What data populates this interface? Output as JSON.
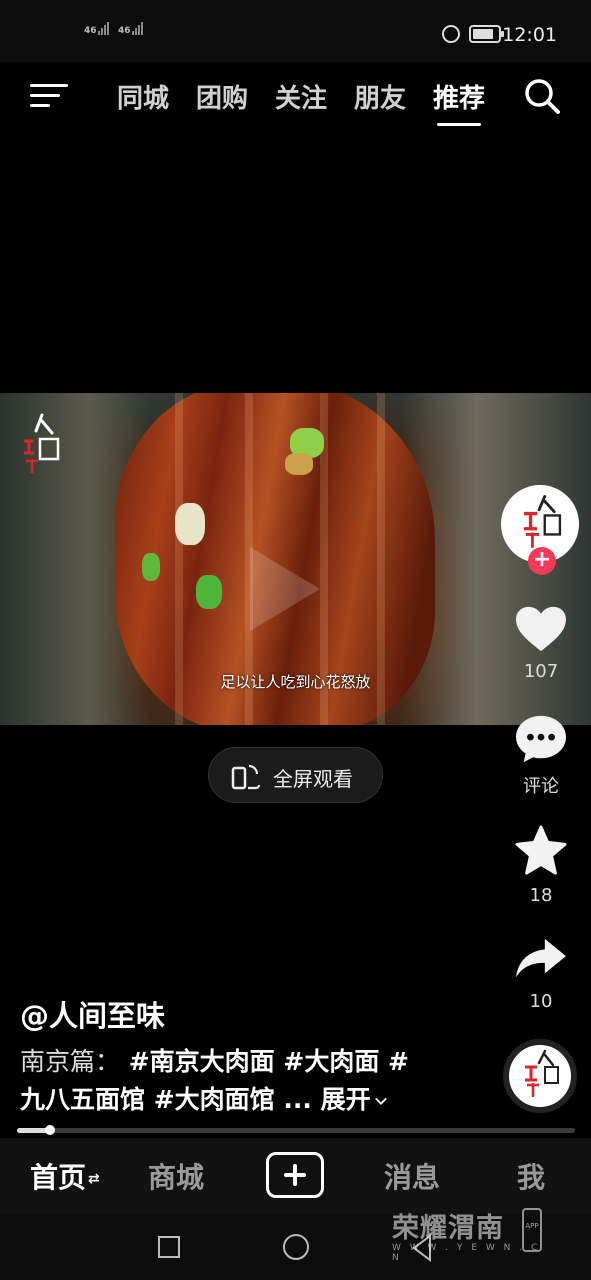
{
  "status_bar": {
    "sim1": "46",
    "sim2": "46",
    "time": "12:01",
    "battery_icon": "battery-icon",
    "dnd_icon": "do-not-disturb-icon"
  },
  "top_nav": {
    "menu_icon": "menu-icon",
    "tabs": [
      {
        "label": "同城",
        "active": false
      },
      {
        "label": "团购",
        "active": false
      },
      {
        "label": "关注",
        "active": false
      },
      {
        "label": "朋友",
        "active": false
      },
      {
        "label": "推荐",
        "active": true
      }
    ],
    "search_icon": "search-icon"
  },
  "video": {
    "subtitle": "足以让人吃到心花怒放",
    "watermark_icon": "channel-watermark-logo"
  },
  "fullscreen": {
    "label": "全屏观看",
    "icon": "rotate-screen-icon"
  },
  "right_rail": {
    "avatar_icon": "author-avatar",
    "follow_icon": "plus-icon",
    "like_count": "107",
    "comment_label": "评论",
    "favorite_count": "18",
    "share_count": "10",
    "music_icon": "music-disc-avatar"
  },
  "caption": {
    "author": "@人间至味",
    "prefix": "南京篇：",
    "tags_line1": "#南京大肉面 #大肉面 #",
    "tags_line2": "九八五面馆 #大肉面馆 ...",
    "expand": "展开"
  },
  "progress": {
    "fraction": 0.06
  },
  "bottom_tabs": [
    {
      "label": "首页",
      "active": true
    },
    {
      "label": "商城",
      "active": false
    },
    {
      "label": "消息",
      "active": false
    },
    {
      "label": "我",
      "active": false
    }
  ],
  "brand_watermark": {
    "name": "荣耀渭南",
    "url": "W W W . Y E W N . C N",
    "app": "APP"
  },
  "colors": {
    "background": "#000000",
    "follow_accent": "#f23a5a",
    "tab_inactive": "#9a9a9a"
  }
}
